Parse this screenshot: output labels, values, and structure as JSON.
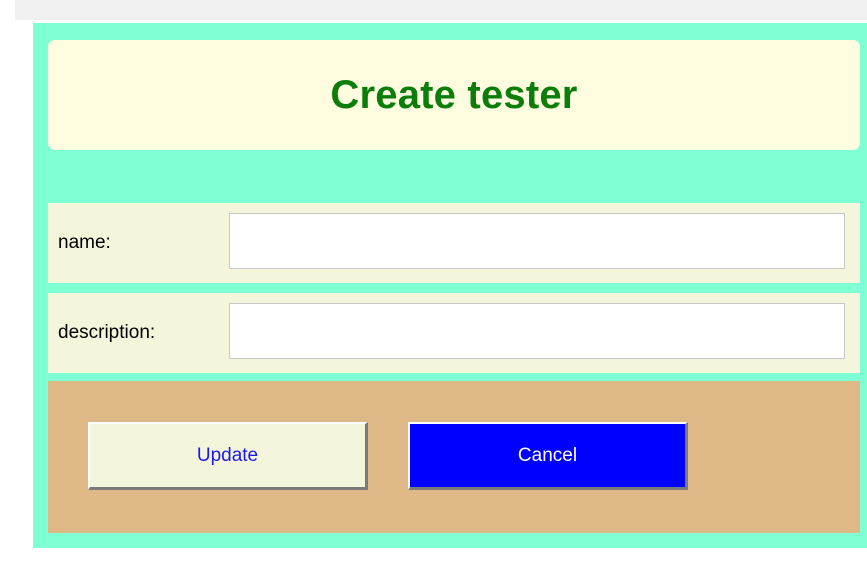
{
  "form": {
    "title": "Create tester",
    "fields": [
      {
        "label": "name:",
        "value": "",
        "placeholder": ""
      },
      {
        "label": "description:",
        "value": "",
        "placeholder": ""
      }
    ],
    "buttons": {
      "update_label": "Update",
      "cancel_label": "Cancel"
    }
  },
  "colors": {
    "panel_background": "#7fffd4",
    "title_background": "#fffde0",
    "title_text": "#0a7d0a",
    "field_row_background": "#f5f5dc",
    "button_bar_background": "#deb887",
    "update_button_background": "#f5f5dc",
    "update_button_text": "#1a1ae6",
    "cancel_button_background": "#0000ff",
    "cancel_button_text": "#ffffff"
  }
}
